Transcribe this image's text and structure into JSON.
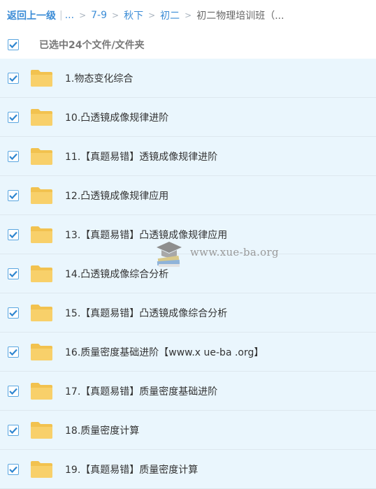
{
  "breadcrumb": {
    "back": "返回上一级",
    "ellipsis": "...",
    "crumbs": [
      "7-9",
      "秋下",
      "初二"
    ],
    "current": "初二物理培训班（..."
  },
  "select_all": {
    "label": "已选中24个文件/文件夹",
    "checked": true
  },
  "files": [
    {
      "name": "1.物态变化综合",
      "checked": true
    },
    {
      "name": "10.凸透镜成像规律进阶",
      "checked": true
    },
    {
      "name": "11.【真题易错】透镜成像规律进阶",
      "checked": true
    },
    {
      "name": "12.凸透镜成像规律应用",
      "checked": true
    },
    {
      "name": "13.【真题易错】凸透镜成像规律应用",
      "checked": true
    },
    {
      "name": "14.凸透镜成像综合分析",
      "checked": true
    },
    {
      "name": "15.【真题易错】凸透镜成像综合分析",
      "checked": true
    },
    {
      "name": "16.质量密度基础进阶【www.x ue-ba .org】",
      "checked": true
    },
    {
      "name": "17.【真题易错】质量密度基础进阶",
      "checked": true
    },
    {
      "name": "18.质量密度计算",
      "checked": true
    },
    {
      "name": "19.【真题易错】质量密度计算",
      "checked": true
    }
  ],
  "watermark": {
    "text": "www.xue-ba.org"
  },
  "colors": {
    "accent": "#3b8cd6",
    "row_bg": "#eaf6fd",
    "folder": "#f8d06a"
  }
}
